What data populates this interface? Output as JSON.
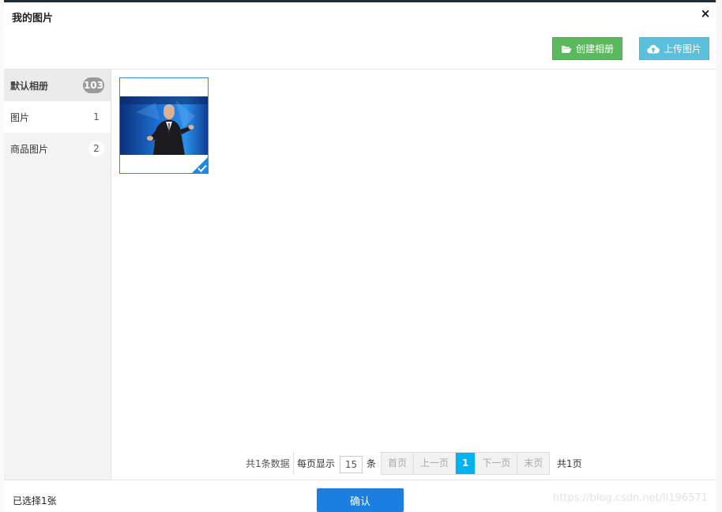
{
  "dialog": {
    "title": "我的图片",
    "close_label": "×"
  },
  "toolbar": {
    "create_album_label": "创建相册",
    "upload_label": "上传图片"
  },
  "sidebar": {
    "items": [
      {
        "label": "默认相册",
        "count": "103"
      },
      {
        "label": "图片",
        "count": "1"
      },
      {
        "label": "商品图片",
        "count": "2"
      }
    ]
  },
  "gallery": {
    "selected_count": 1
  },
  "pagination": {
    "total_text": "共1条数据",
    "per_page_label": "每页显示",
    "per_page_value": "15",
    "per_page_unit": "条",
    "first": "首页",
    "prev": "上一页",
    "current": "1",
    "next": "下一页",
    "last": "末页",
    "pages_text": "共1页"
  },
  "footer": {
    "selected_text": "已选择1张",
    "confirm_label": "确认"
  },
  "watermark": "https://blog.csdn.net/li196571",
  "colors": {
    "create_btn": "#5cb85c",
    "upload_btn": "#5bc0de",
    "confirm_btn": "#1a7fe0",
    "current_page": "#00b3ee",
    "selection_border": "#2b8ad9"
  }
}
